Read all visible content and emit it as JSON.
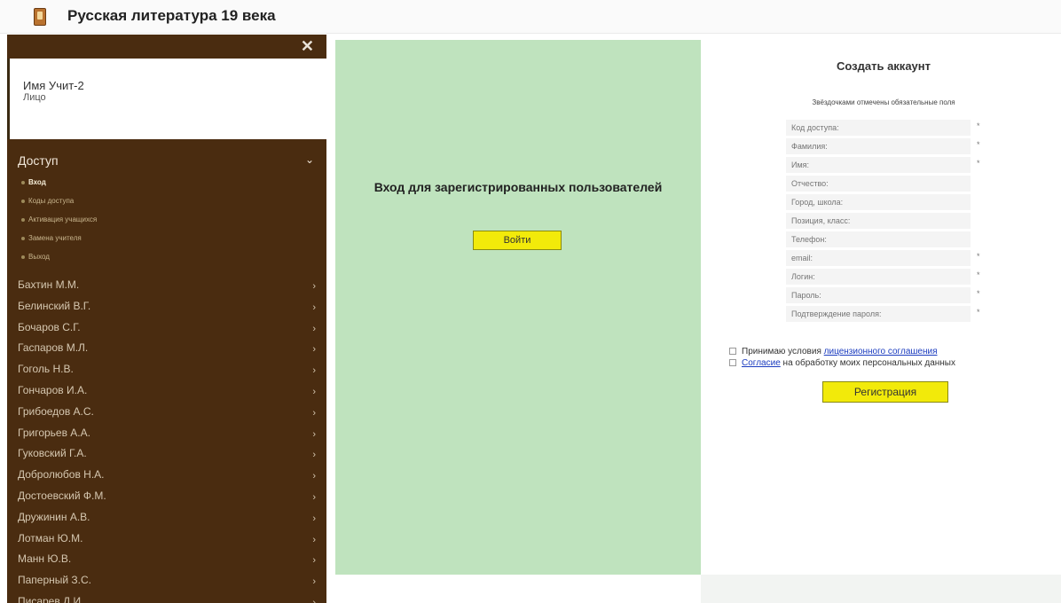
{
  "app": {
    "title": "Русская литература 19 века",
    "icon": "book-icon"
  },
  "sidebar": {
    "close_glyph": "✕",
    "user": {
      "name": "Имя Учит-2",
      "role": "Лицо"
    },
    "section": {
      "label": "Доступ",
      "chevron": "⌄"
    },
    "subitems": [
      {
        "label": "Вход",
        "active": true
      },
      {
        "label": "Коды доступа",
        "active": false
      },
      {
        "label": "Активация учащихся",
        "active": false
      },
      {
        "label": "Замена учителя",
        "active": false
      },
      {
        "label": "Выход",
        "active": false
      }
    ],
    "authors": [
      "Бахтин М.М.",
      "Белинский В.Г.",
      "Бочаров С.Г.",
      "Гаспаров М.Л.",
      "Гоголь Н.В.",
      "Гончаров И.А.",
      "Грибоедов А.С.",
      "Григорьев А.А.",
      "Гуковский Г.А.",
      "Добролюбов Н.А.",
      "Достоевский Ф.М.",
      "Дружинин А.В.",
      "Лотман Ю.М.",
      "Манн Ю.В.",
      "Паперный З.С.",
      "Писарев Д.И."
    ]
  },
  "login": {
    "heading": "Вход для зарегистрированных пользователей",
    "button_label": "Войти"
  },
  "register": {
    "title": "Создать аккаунт",
    "note": "Звёздочками отмечены обязательные поля",
    "fields": [
      {
        "placeholder": "Код доступа:",
        "required": true
      },
      {
        "placeholder": "Фамилия:",
        "required": true
      },
      {
        "placeholder": "Имя:",
        "required": true
      },
      {
        "placeholder": "Отчество:",
        "required": false
      },
      {
        "placeholder": "Город, школа:",
        "required": false
      },
      {
        "placeholder": "Позиция, класс:",
        "required": false
      },
      {
        "placeholder": "Телефон:",
        "required": false
      },
      {
        "placeholder": "email:",
        "required": true
      },
      {
        "placeholder": "Логин:",
        "required": true
      },
      {
        "placeholder": "Пароль:",
        "required": true
      },
      {
        "placeholder": "Подтверждение пароля:",
        "required": true
      }
    ],
    "agree1_text": "Принимаю условия ",
    "agree1_link": "лицензионного соглашения",
    "agree2_link": "Согласие",
    "agree2_text": " на обработку моих персональных данных",
    "button_label": "Регистрация"
  },
  "colors": {
    "sidebar_bg": "#4a2c10",
    "green_panel": "#bfe3be",
    "button_yellow": "#f2ea0a",
    "link_blue": "#1a3bbf"
  }
}
